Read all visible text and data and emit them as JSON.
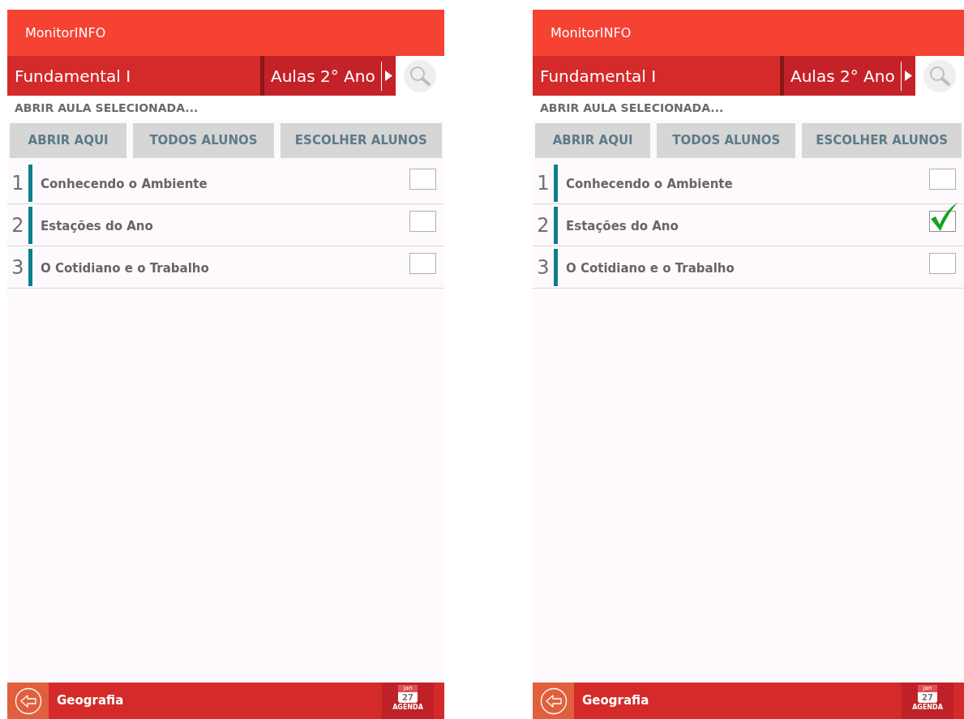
{
  "screens": [
    {
      "app_title": "MonitorINFO",
      "category": "Fundamental I",
      "lessons_dropdown": "Aulas 2° Ano",
      "prompt": "ABRIR AULA SELECIONADA...",
      "buttons": [
        "ABRIR AQUI",
        "TODOS ALUNOS",
        "ESCOLHER ALUNOS"
      ],
      "lessons": [
        {
          "number": "1",
          "title": "Conhecendo o Ambiente",
          "checked": false
        },
        {
          "number": "2",
          "title": "Estações do Ano",
          "checked": false
        },
        {
          "number": "3",
          "title": "O Cotidiano e o Trabalho",
          "checked": false
        }
      ],
      "footer": {
        "subject": "Geografia",
        "calendar": {
          "month": "jan",
          "day": "27",
          "label": "AGENDA"
        }
      }
    },
    {
      "app_title": "MonitorINFO",
      "category": "Fundamental I",
      "lessons_dropdown": "Aulas 2° Ano",
      "prompt": "ABRIR AULA SELECIONADA...",
      "buttons": [
        "ABRIR AQUI",
        "TODOS ALUNOS",
        "ESCOLHER ALUNOS"
      ],
      "lessons": [
        {
          "number": "1",
          "title": "Conhecendo o Ambiente",
          "checked": false
        },
        {
          "number": "2",
          "title": "Estações do Ano",
          "checked": true
        },
        {
          "number": "3",
          "title": "O Cotidiano e o Trabalho",
          "checked": false
        }
      ],
      "footer": {
        "subject": "Geografia",
        "calendar": {
          "month": "jan",
          "day": "27",
          "label": "AGENDA"
        }
      }
    }
  ]
}
